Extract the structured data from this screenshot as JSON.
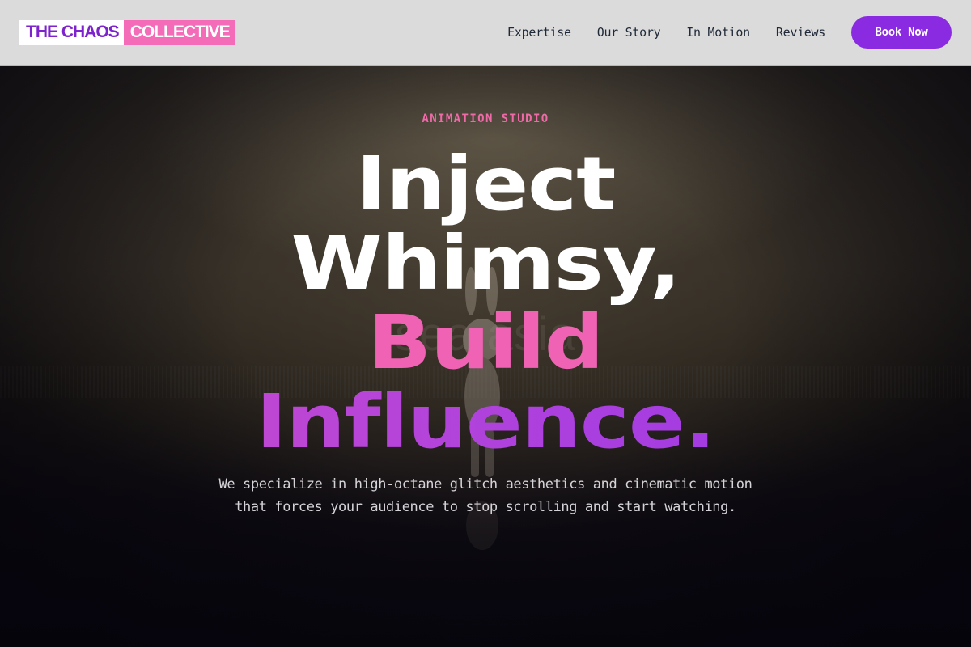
{
  "brand": {
    "part1": "THE CHAOS",
    "part2": "COLLECTIVE"
  },
  "nav": {
    "items": [
      {
        "label": "Expertise"
      },
      {
        "label": "Our Story"
      },
      {
        "label": "In Motion"
      },
      {
        "label": "Reviews"
      }
    ],
    "cta_label": "Book Now"
  },
  "hero": {
    "eyebrow": "ANIMATION STUDIO",
    "headline": {
      "line1": "Inject",
      "line2": "Whimsy,",
      "line3": "Build",
      "line4": "Influence."
    },
    "subtext_line1": "We specialize in high-octane glitch aesthetics and cinematic motion",
    "subtext_line2": "that forces your audience to stop scrolling and start watching.",
    "background_watermark": "sea       asia"
  },
  "colors": {
    "accent_purple": "#8a2be2",
    "accent_pink": "#f06aa8",
    "header_bg": "#dcdbdc",
    "hero_bg_dark": "#0e0b12"
  }
}
